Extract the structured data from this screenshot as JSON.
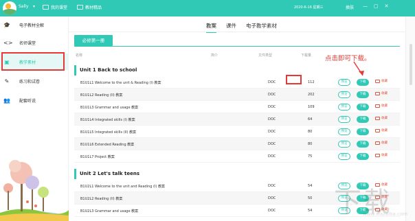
{
  "titlebar": {
    "user": "Sally",
    "nav": [
      "我的课堂",
      "教材精品"
    ],
    "date": "2020-6-16 星期三",
    "skin": "换肤",
    "controls": [
      "—",
      "▢",
      "✕"
    ]
  },
  "sidebar": {
    "items": [
      {
        "icon": "graduation-cap-icon",
        "glyph": "🎓",
        "label": "电子教材全解"
      },
      {
        "icon": "code-icon",
        "glyph": "<>",
        "label": "名师课堂"
      },
      {
        "icon": "chat-icon",
        "glyph": "▣",
        "label": "教学素材",
        "active": true
      },
      {
        "icon": "pencil-icon",
        "glyph": "✎",
        "label": "练习和试卷"
      },
      {
        "icon": "user-add-icon",
        "glyph": "👥",
        "label": "配套听说"
      }
    ]
  },
  "tabs": [
    "教案",
    "课件",
    "电子教学素材"
  ],
  "book_label": "必修第一册",
  "columns": {
    "name": "名称",
    "intro": "简介",
    "format": "文件类型",
    "downloads": "下载量"
  },
  "units": [
    {
      "title": "Unit 1 Back to school",
      "rows": [
        {
          "name": "B1U1L1 Welcome to the unit & Reading (I) 教案",
          "type": "DOC",
          "count": "112"
        },
        {
          "name": "B1U1L2 Reading (II) 教案",
          "type": "DOC",
          "count": "202"
        },
        {
          "name": "B1U1L3 Grammar and usage 教案",
          "type": "DOC",
          "count": "109"
        },
        {
          "name": "B1U1L4 Integrated skills (I) 教案",
          "type": "DOC",
          "count": "64"
        },
        {
          "name": "B1U1L5 Integrated skills (II) 教案",
          "type": "DOC",
          "count": "80"
        },
        {
          "name": "B1U1L6 Extended Reading 教案",
          "type": "DOC",
          "count": "80"
        },
        {
          "name": "B1U1L7 Project 教案",
          "type": "DOC",
          "count": "75"
        }
      ]
    },
    {
      "title": "Unit 2 Let's talk teens",
      "rows": [
        {
          "name": "B1U2L1 Welcome to the unit and Reading (I) 教案",
          "type": "DOC",
          "count": "54"
        },
        {
          "name": "B1U2L2 Reading (II) 教案",
          "type": "DOC",
          "count": "50"
        },
        {
          "name": "B1U2L3 Grammar and usage 教案",
          "type": "DOC",
          "count": "54"
        }
      ]
    }
  ],
  "row_actions": {
    "preview": "预览",
    "download": "下载",
    "collect": "收藏"
  },
  "annotation": "点击即可下载。",
  "watermark": {
    "main": "下载",
    "sub": "www.xiazaiba.com"
  },
  "colors": {
    "accent": "#2fc9b5",
    "highlight": "#e53935"
  }
}
